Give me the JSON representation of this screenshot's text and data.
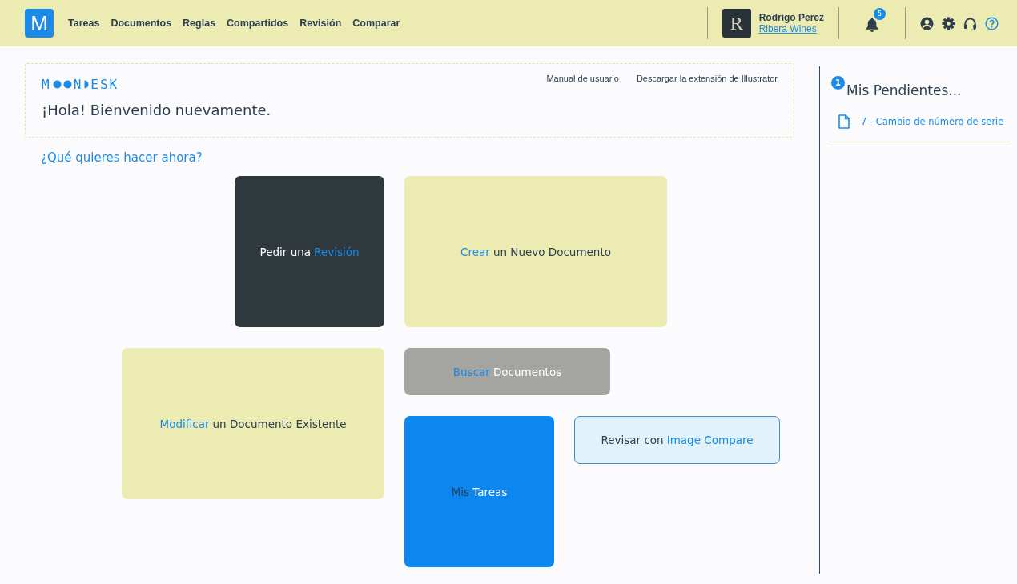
{
  "header": {
    "logo_letter": "M",
    "nav": [
      {
        "label": "Tareas"
      },
      {
        "label": "Documentos"
      },
      {
        "label": "Reglas"
      },
      {
        "label": "Compartidos"
      },
      {
        "label": "Revisión"
      },
      {
        "label": "Comparar"
      }
    ],
    "user": {
      "avatar_letter": "R",
      "name": "Rodrigo Perez",
      "company": "Ribera Wines"
    },
    "notifications": {
      "count": "5"
    }
  },
  "welcome": {
    "logo": {
      "start": "M",
      "middle": "N",
      "end": "ESK"
    },
    "links": [
      "Manual de usuario",
      "Descargar la extensión de Illustrator"
    ],
    "greeting": "¡Hola! Bienvenido nuevamente."
  },
  "prompt": "¿Qué quieres hacer ahora?",
  "tiles": [
    {
      "kind": "dark",
      "parts": [
        {
          "text": "Pedir una",
          "accent": false
        },
        {
          "text": "Revisión",
          "accent": true
        }
      ]
    },
    {
      "kind": "yellow",
      "parts": [
        {
          "text": "Crear",
          "accent": true
        },
        {
          "text": "un Nuevo Documento",
          "accent": false
        }
      ]
    },
    {
      "kind": "yellow",
      "parts": [
        {
          "text": "Modificar",
          "accent": true
        },
        {
          "text": "un Documento Existente",
          "accent": false
        }
      ]
    },
    {
      "kind": "grey",
      "parts": [
        {
          "text": "Buscar",
          "accent": true
        },
        {
          "text": "Documentos",
          "accent": false
        }
      ]
    },
    {
      "kind": "blue",
      "parts": [
        {
          "text": "Mis",
          "accent": true
        },
        {
          "text": "Tareas",
          "accent": false
        }
      ]
    },
    {
      "kind": "outline",
      "parts": [
        {
          "text": "Revisar con",
          "accent": false
        },
        {
          "text": "Image Compare",
          "accent": true
        }
      ]
    }
  ],
  "pending": {
    "count": "1",
    "title": "Mis Pendientes...",
    "items": [
      {
        "label": "7 - Cambio de número de serie"
      }
    ]
  }
}
